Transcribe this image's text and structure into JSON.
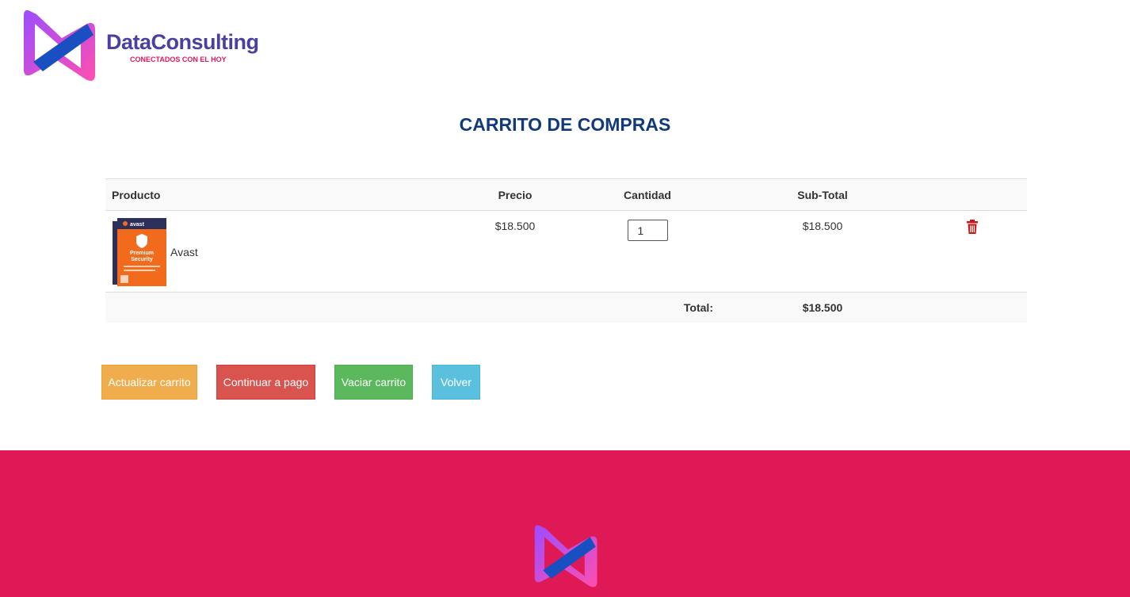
{
  "brand": {
    "name": "DataConsulting",
    "tagline": "CONECTADOS CON EL HOY",
    "logo_icon": "dataconsulting-logo-icon",
    "colors": {
      "purple": "#4b3fa0",
      "pink": "#e0195a",
      "blue": "#103a7b"
    }
  },
  "page": {
    "title": "CARRITO DE COMPRAS"
  },
  "table": {
    "headers": {
      "product": "Producto",
      "price": "Precio",
      "quantity": "Cantidad",
      "subtotal": "Sub-Total"
    },
    "items": [
      {
        "name": "Avast",
        "image": "avast-premium-security-box",
        "price": "$18.500",
        "quantity": "1",
        "subtotal": "$18.500",
        "delete_icon": "trash-icon"
      }
    ],
    "total_label": "Total:",
    "total_value": "$18.500"
  },
  "buttons": {
    "update": "Actualizar carrito",
    "pay": "Continuar a pago",
    "empty": "Vaciar carrito",
    "back": "Volver"
  },
  "button_colors": {
    "update": "#f0ad4e",
    "pay": "#d9534f",
    "empty": "#5cb85c",
    "back": "#5bc0de"
  },
  "footer": {
    "background": "#df1956",
    "logo_icon": "dataconsulting-logo-icon"
  }
}
